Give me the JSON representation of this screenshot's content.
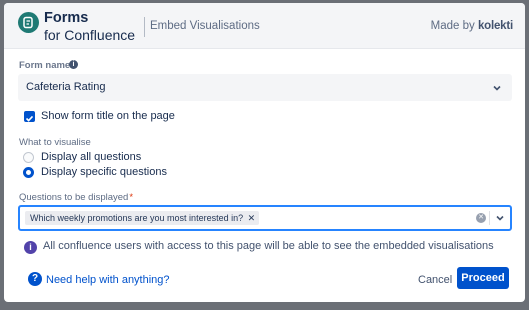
{
  "header": {
    "brand_line1": "Forms",
    "brand_line2": "for Confluence",
    "title": "Embed Visualisations",
    "made_by": "Made by",
    "made_by_brand": "kolekti"
  },
  "form": {
    "form_name_label": "Form name",
    "form_name_value": "Cafeteria Rating",
    "show_title_label": "Show form title on the page",
    "show_title_checked": true,
    "visualise_label": "What to visualise",
    "options": [
      "Display all questions",
      "Display specific questions"
    ],
    "selected_option": "Display specific questions",
    "questions_label": "Questions to be displayed",
    "selected_questions": [
      "Which weekly promotions are you most interested in?"
    ],
    "note": "All confluence users with access to this page will be able to see the embedded visualisations"
  },
  "footer": {
    "help": "Need help with anything?",
    "cancel": "Cancel",
    "proceed": "Proceed"
  },
  "icons": {
    "logo": "forms-logo-icon",
    "info": "info-icon",
    "check": "check-icon",
    "chevron": "chevron-down-icon",
    "clear": "clear-icon",
    "help": "question-icon"
  },
  "colors": {
    "primary": "#0052cc",
    "logo": "#1f7a74",
    "note_icon": "#5243aa",
    "focus_border": "#2684ff"
  }
}
